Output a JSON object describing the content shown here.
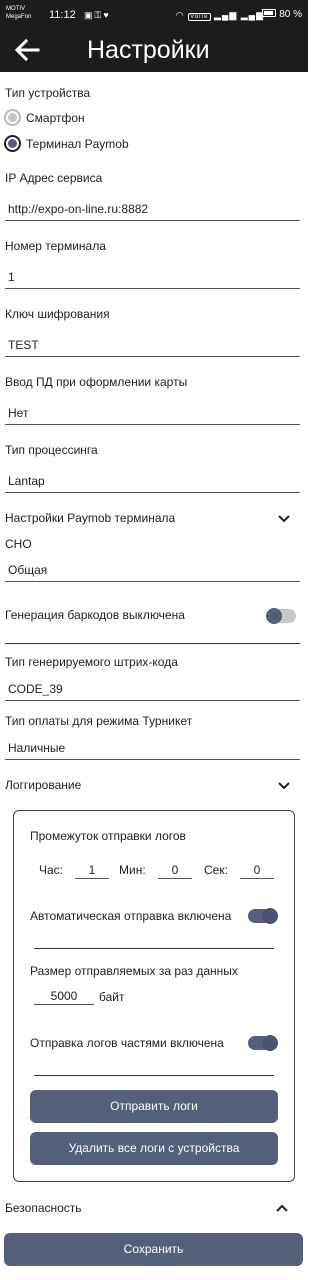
{
  "status_bar": {
    "carrier_line1": "MOTIV",
    "carrier_line2": "MegaFon",
    "time": "11:12",
    "network_text": "Volte",
    "battery": "80 %"
  },
  "app_bar": {
    "title": "Настройки",
    "back_icon": "arrow-left-icon"
  },
  "device_type": {
    "label": "Тип устройства",
    "options": [
      {
        "label": "Смартфон",
        "selected": false
      },
      {
        "label": "Терминал Paymob",
        "selected": true
      }
    ]
  },
  "service_ip": {
    "label": "IP Адрес сервиса",
    "value": "http://expo-on-line.ru:8882"
  },
  "terminal_number": {
    "label": "Номер терминала",
    "value": "1"
  },
  "encryption_key": {
    "label": "Ключ шифрования",
    "value": "TEST"
  },
  "pd_input": {
    "label": "Ввод ПД при оформлении карты",
    "value": "Нет"
  },
  "processing_type": {
    "label": "Тип процессинга",
    "value": "Lantap"
  },
  "paymob_settings": {
    "label": "Настройки Paymob терминала",
    "sno_label": "СНО",
    "sno_value": "Общая",
    "barcode_gen_label": "Генерация баркодов выключена",
    "barcode_gen_on": false,
    "barcode_type_label": "Тип генерируемого штрих-кода",
    "barcode_type_value": "CODE_39",
    "turnstile_payment_label": "Тип оплаты для режима Турникет",
    "turnstile_payment_value": "Наличные"
  },
  "logging": {
    "label": "Логгирование",
    "interval_label": "Промежуток отправки логов",
    "hour_label": "Час:",
    "hour_value": "1",
    "min_label": "Мин:",
    "min_value": "0",
    "sec_label": "Сек:",
    "sec_value": "0",
    "auto_send_label": "Автоматическая отправка включена",
    "auto_send_on": true,
    "batch_size_label": "Размер отправляемых за раз данных",
    "batch_size_value": "5000",
    "batch_size_unit": "байт",
    "chunked_label": "Отправка логов частями включена",
    "chunked_on": true,
    "send_button": "Отправить логи",
    "delete_button": "Удалить все логи с устройства"
  },
  "security": {
    "label": "Безопасность"
  },
  "save_button": "Сохранить"
}
